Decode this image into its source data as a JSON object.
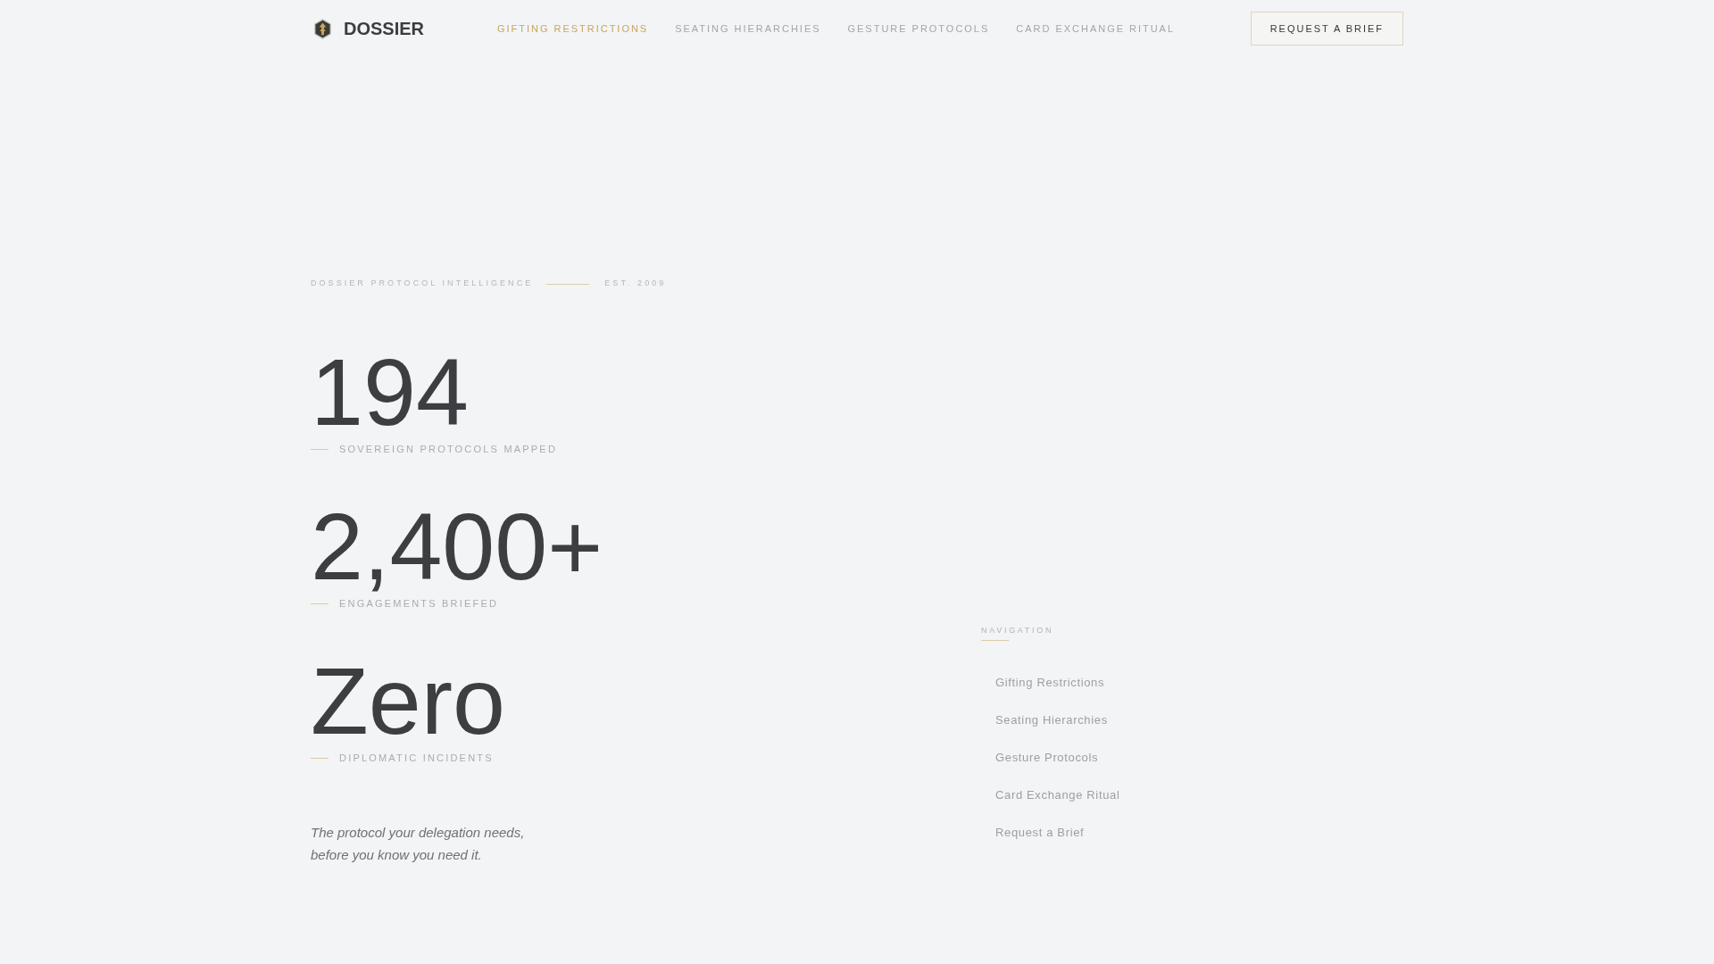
{
  "header": {
    "brand": "DOSSIER",
    "nav": [
      {
        "label": "GIFTING RESTRICTIONS",
        "selected": true
      },
      {
        "label": "SEATING HIERARCHIES",
        "selected": false
      },
      {
        "label": "GESTURE PROTOCOLS",
        "selected": false
      },
      {
        "label": "CARD EXCHANGE RITUAL",
        "selected": false
      }
    ],
    "cta": "REQUEST A BRIEF"
  },
  "hero": {
    "eyebrow": "DOSSIER PROTOCOL INTELLIGENCE",
    "established": "EST. 2009",
    "stats": [
      {
        "value": "194",
        "label": "SOVEREIGN PROTOCOLS MAPPED"
      },
      {
        "value": "2,400+",
        "label": "ENGAGEMENTS BRIEFED"
      },
      {
        "value": "Zero",
        "label": "DIPLOMATIC INCIDENTS"
      }
    ],
    "tagline": [
      "The protocol your delegation needs,",
      "before you know you need it."
    ]
  },
  "side_nav": {
    "title": "NAVIGATION",
    "items": [
      "Gifting Restrictions",
      "Seating Hierarchies",
      "Gesture Protocols",
      "Card Exchange Ritual",
      "Request a Brief"
    ]
  }
}
